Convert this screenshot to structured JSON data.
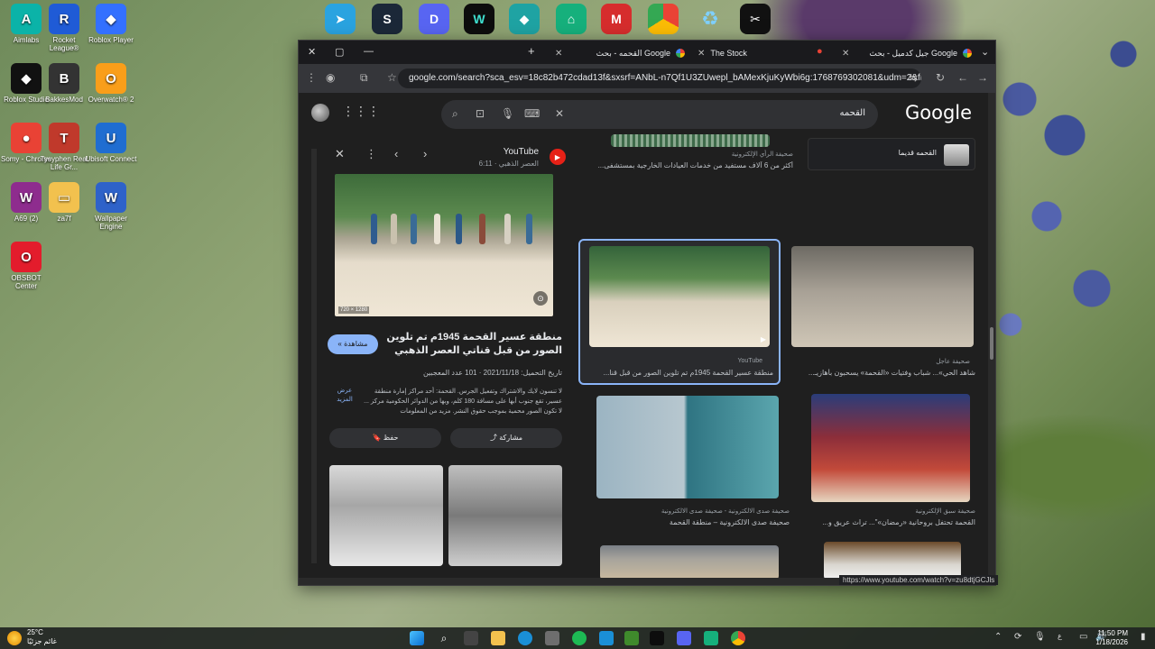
{
  "desktop": {
    "icons": [
      {
        "label": "Aimlabs",
        "color": "#0bb3a8",
        "glyph": "A"
      },
      {
        "label": "Rocket League®",
        "color": "#1f5bd6",
        "glyph": "R"
      },
      {
        "label": "Roblox Player",
        "color": "#3370ff",
        "glyph": "◆"
      },
      {
        "label": "Roblox Studio",
        "color": "#111111",
        "glyph": "◆"
      },
      {
        "label": "BakkesMod",
        "color": "#333333",
        "glyph": "B"
      },
      {
        "label": "Overwatch® 2",
        "color": "#f99e1a",
        "glyph": "O"
      },
      {
        "label": "Somy - Chrome",
        "color": "#e94235",
        "glyph": "●"
      },
      {
        "label": "Tysyphen Real Life Gr...",
        "color": "#c0392b",
        "glyph": "T"
      },
      {
        "label": "Ubisoft Connect",
        "color": "#1f6dd1",
        "glyph": "U"
      },
      {
        "label": "A69 (2)",
        "color": "#8e2c8e",
        "glyph": "W"
      },
      {
        "label": "za7f",
        "color": "#f2c14e",
        "glyph": "▭"
      },
      {
        "label": "Wallpaper Engine",
        "color": "#2e62c9",
        "glyph": "W"
      },
      {
        "label": "OBSBOT Center",
        "color": "#e31c2c",
        "glyph": "O"
      }
    ],
    "top_icons": [
      {
        "label": "Telegram",
        "color": "#2aa3e0",
        "glyph": "➤"
      },
      {
        "label": "Steam",
        "color": "#1b2838",
        "glyph": "S"
      },
      {
        "label": "Discord",
        "color": "#5865f2",
        "glyph": "D"
      },
      {
        "label": "Tracker",
        "color": "#0d0d0d",
        "glyph": "W"
      },
      {
        "label": "Valorant Tracker",
        "color": "#1fa3a3",
        "glyph": "◆"
      },
      {
        "label": "Overwolf",
        "color": "#16b07c",
        "glyph": "⌂"
      },
      {
        "label": "Medal",
        "color": "#d62d2d",
        "glyph": "M"
      },
      {
        "label": "Chrome",
        "color": "#4285f4",
        "glyph": "●"
      },
      {
        "label": "Recycle Bin",
        "color": "#4fa3d9",
        "glyph": "♻"
      },
      {
        "label": "CapCut",
        "color": "#111111",
        "glyph": "✂"
      }
    ]
  },
  "browser": {
    "tabs": [
      {
        "title": "جيل كدميل - بحث Google",
        "active": false
      },
      {
        "title": "The Stock",
        "active": false
      },
      {
        "title": "القحمه - بحث Google",
        "active": true
      }
    ],
    "url": "google.com/search?sca_esv=18c82b472cdad13f&sxsrf=ANbL-n7Qf1U3ZUwepl_bAMexKjuKyWbi6g:1768769302081&udm=2&fbs...",
    "search_query": "القحمه",
    "logo": "Google"
  },
  "panel": {
    "source": "YouTube",
    "source_sub": "العصر الذهبي · 6:11",
    "dims": "720 × 1280",
    "title": "منطقة عسير القحمة 1945م تم تلوين الصور من قبل قناتي العصر الذهبي",
    "watch": "مشاهدة",
    "meta": "تاريخ التحميل: 2021/11/18 · 101 عدد المعجبين",
    "description": "لا تنسون لايك والاشتراك وتفعيل الجرس. القحمة: أحد مراكز إمارة منطقة عسير، تقع جنوب أبها على مسافة 180 كلم، وبها من الدوائر الحكومية مركز ... لا تكون الصور محمية بموجب حقوق النشر. مزيد من المعلومات",
    "more": "عرض المزيد",
    "save": "حفظ",
    "share": "مشاركة"
  },
  "results": [
    {
      "source": "صحيفة الرأي الإلكترونية",
      "caption": "أكثر من 6 آلاف مستفيد من خدمات العيادات الخارجية بمستشفى..."
    },
    {
      "source": "",
      "caption": "القحمه قديما"
    },
    {
      "source": "YouTube",
      "caption": "منطقة عسير القحمة 1945م تم تلوين الصور من قبل قنا..."
    },
    {
      "source": "صحيفة عاجل",
      "caption": "شاهد الحي»... شباب وفتيات «القحمة» يسحبون بأهازيـ..."
    },
    {
      "source": "صحيفة صدى الالكترونية - صحيفة صدى الالكترونية",
      "caption": "صحيفة صدى الالكترونية – منطقة القحمة"
    },
    {
      "source": "صحيفة سبق الإلكترونية",
      "caption": "القحمة تحتفل بروحانية «رمضان»\"... تراث عريق و..."
    }
  ],
  "status_url": "https://www.youtube.com/watch?v=zu8dtjGCJls",
  "taskbar": {
    "weather_temp": "25°C",
    "weather_desc": "غائم جزئيًا",
    "time": "11:50 PM",
    "date": "1/18/2026",
    "lang": "ع"
  },
  "colors": {
    "accent": "#8ab4f8",
    "page_bg": "#1f1f1f",
    "youtube": "#e62117"
  }
}
